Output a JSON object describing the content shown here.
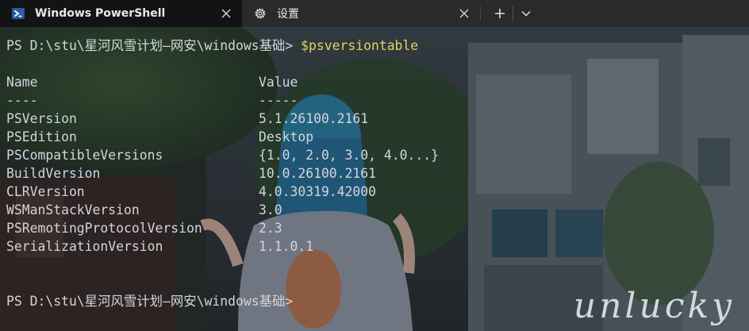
{
  "tabs": [
    {
      "label": "Windows PowerShell",
      "icon": "powershell-icon",
      "active": true
    },
    {
      "label": "设置",
      "icon": "gear-icon",
      "active": false
    }
  ],
  "tab_actions": {
    "new_tab": "+",
    "dropdown": "⌄"
  },
  "terminal": {
    "prompt1": "PS D:\\stu\\星河风雪计划—网安\\windows基础> ",
    "command": "$psversiontable",
    "header": {
      "name": "Name",
      "value": "Value"
    },
    "underline": {
      "name": "----",
      "value": "-----"
    },
    "rows": [
      {
        "name": "PSVersion",
        "value": "5.1.26100.2161"
      },
      {
        "name": "PSEdition",
        "value": "Desktop"
      },
      {
        "name": "PSCompatibleVersions",
        "value": "{1.0, 2.0, 3.0, 4.0...}"
      },
      {
        "name": "BuildVersion",
        "value": "10.0.26100.2161"
      },
      {
        "name": "CLRVersion",
        "value": "4.0.30319.42000"
      },
      {
        "name": "WSManStackVersion",
        "value": "3.0"
      },
      {
        "name": "PSRemotingProtocolVersion",
        "value": "2.3"
      },
      {
        "name": "SerializationVersion",
        "value": "1.1.0.1"
      }
    ],
    "prompt2": "PS D:\\stu\\星河风雪计划—网安\\windows基础>"
  },
  "watermark": "unlucky",
  "colors": {
    "prompt_text": "#d2d6dc",
    "command": "#e5d35a",
    "tab_active_bg": "#111315",
    "tabbar_bg": "#2a2a2a",
    "powershell_blue": "#2c5aa0"
  }
}
